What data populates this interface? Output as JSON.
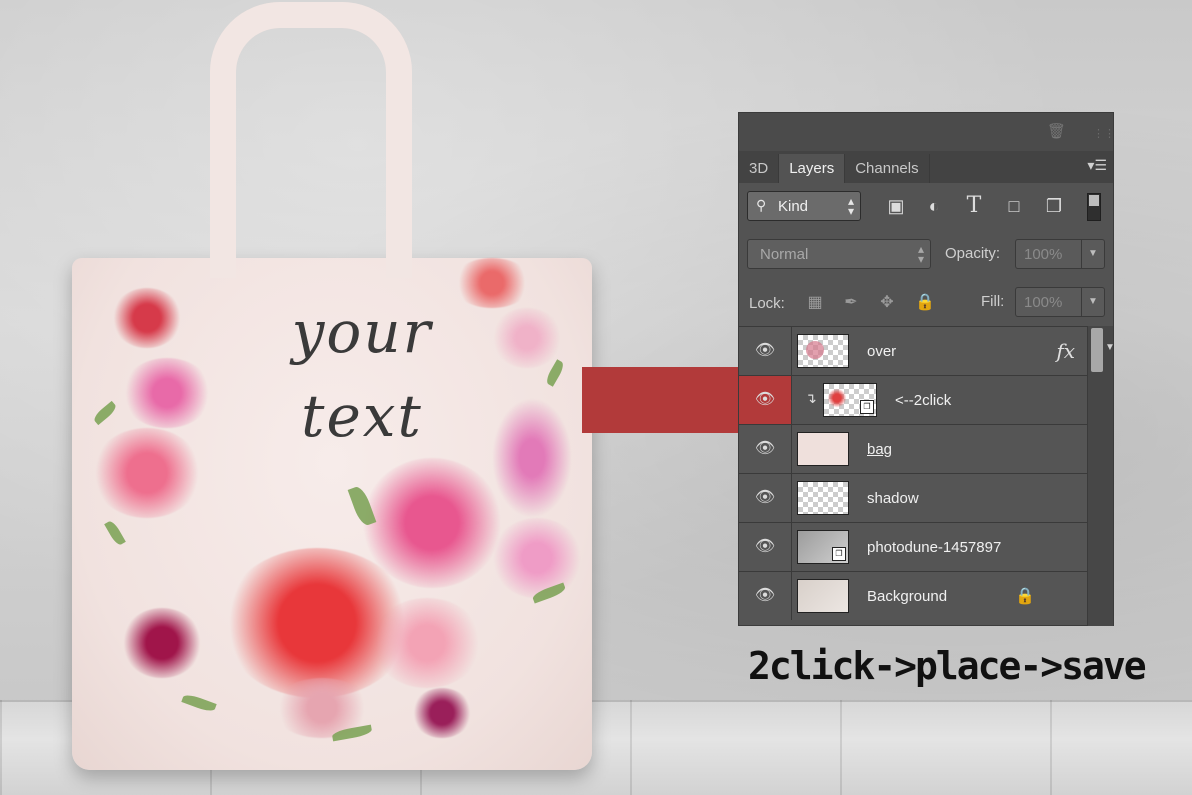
{
  "bag": {
    "text_line1": "your",
    "text_line2": "text"
  },
  "panel": {
    "tabs": [
      {
        "label": "3D",
        "active": false
      },
      {
        "label": "Layers",
        "active": true
      },
      {
        "label": "Channels",
        "active": false
      }
    ],
    "filter": {
      "kind_label": "Kind",
      "icons": [
        "image-filter-icon",
        "adjustment-filter-icon",
        "type-filter-icon",
        "shape-filter-icon",
        "smart-object-filter-icon"
      ]
    },
    "blend_mode": "Normal",
    "opacity_label": "Opacity:",
    "opacity_value": "100%",
    "lock_label": "Lock:",
    "fill_label": "Fill:",
    "fill_value": "100%",
    "layers": [
      {
        "name": "over",
        "fx": "fx",
        "selected": false
      },
      {
        "name": "<--2click",
        "selected": true,
        "clipped": true,
        "smart": true
      },
      {
        "name": "bag",
        "selected": false
      },
      {
        "name": "shadow",
        "selected": false
      },
      {
        "name": "photodune-1457897",
        "selected": false,
        "smart": true
      },
      {
        "name": "Background",
        "selected": false,
        "locked": true
      }
    ]
  },
  "instruction": "2click->place->save",
  "colors": {
    "accent_red": "#b23a3a",
    "panel_bg": "#535353",
    "panel_dark": "#434343"
  }
}
